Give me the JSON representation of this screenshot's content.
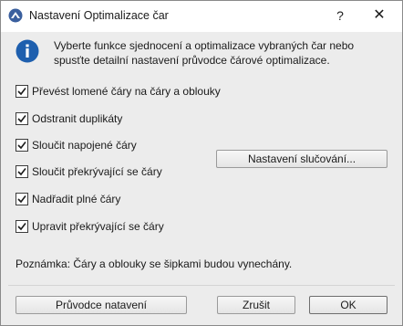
{
  "window": {
    "title": "Nastavení Optimalizace čar",
    "help_label": "?",
    "close_label": "✕"
  },
  "info": {
    "icon": "info-icon",
    "text": "Vyberte funkce sjednocení a optimalizace vybraných čar nebo spusťte detailní nastavení průvodce čárové optimalizace."
  },
  "options": [
    {
      "label": "Převést lomené čáry na čáry a oblouky",
      "checked": true
    },
    {
      "label": "Odstranit duplikáty",
      "checked": true
    },
    {
      "label": "Sloučit napojené čáry",
      "checked": true
    },
    {
      "label": "Sloučit překrývající se čáry",
      "checked": true
    },
    {
      "label": "Nadřadit plné čáry",
      "checked": true
    },
    {
      "label": "Upravit překrývající se čáry",
      "checked": true
    }
  ],
  "merge_settings_label": "Nastavení slučování...",
  "note": "Poznámka: Čáry a oblouky se šipkami budou vynechány.",
  "footer": {
    "wizard_label": "Průvodce natavení",
    "cancel_label": "Zrušit",
    "ok_label": "OK"
  },
  "colors": {
    "app_icon": "#3a5f9e",
    "info_icon": "#1e5fae",
    "dialog_background": "#ececec"
  }
}
